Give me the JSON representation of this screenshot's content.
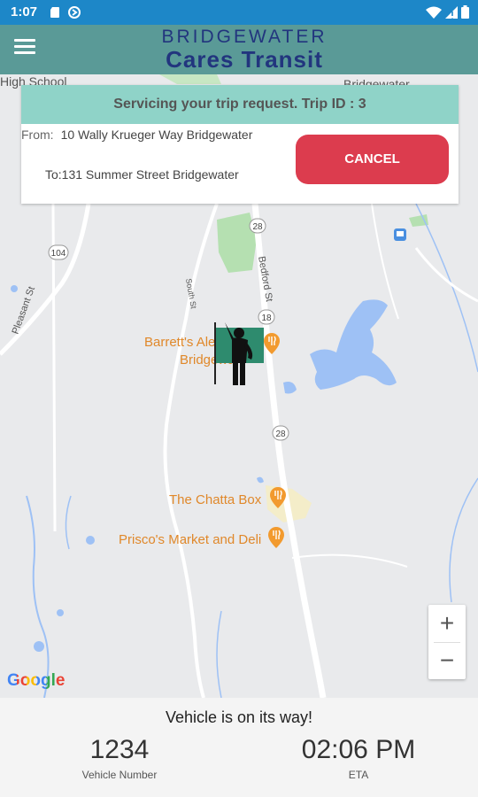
{
  "status_bar": {
    "time": "1:07",
    "left_icons": [
      "sd-card-icon",
      "data-saver-icon"
    ],
    "right_icons": [
      "wifi-icon",
      "signal-icon",
      "battery-icon"
    ]
  },
  "app_bar": {
    "brand_line1": "BRIDGEWATER",
    "brand_line2": "Cares Transit",
    "menu_icon": "hamburger-menu-icon"
  },
  "trip": {
    "header": "Servicing your trip request. Trip ID : 3",
    "from_label": "From:",
    "from_address": "10 Wally Krueger Way Bridgewater",
    "to_text": "To:131 Summer Street Bridgewater",
    "cancel_label": "CANCEL"
  },
  "map": {
    "labels": {
      "high_school": "High School",
      "bridgewater_top": "Bridgewater",
      "pleasant_st": "Pleasant St",
      "south_st": "South St",
      "bedford_st": "Bedford St",
      "route_104": "104",
      "route_28_a": "28",
      "route_18": "18",
      "route_28_b": "28"
    },
    "pois": {
      "barretts_line1": "Barrett's Ale",
      "barretts_line2": "Bridgewa",
      "chatta_box": "The Chatta Box",
      "priscos": "Prisco's Market and Deli"
    },
    "marker_icon": "person-waving-flag-icon",
    "zoom_in": "+",
    "zoom_out": "−",
    "attribution": "Google"
  },
  "bottom": {
    "status": "Vehicle is on its way!",
    "vehicle_number": "1234",
    "vehicle_number_label": "Vehicle Number",
    "eta": "02:06 PM",
    "eta_label": "ETA"
  },
  "colors": {
    "status_bar": "#1d87c8",
    "app_bar": "#5a9a97",
    "brand_text": "#22357e",
    "trip_header": "#8fd3c8",
    "cancel_button": "#dc3c4e",
    "poi_text": "#e0882a",
    "water": "#9ec1f5",
    "park": "#b5e0b1"
  }
}
